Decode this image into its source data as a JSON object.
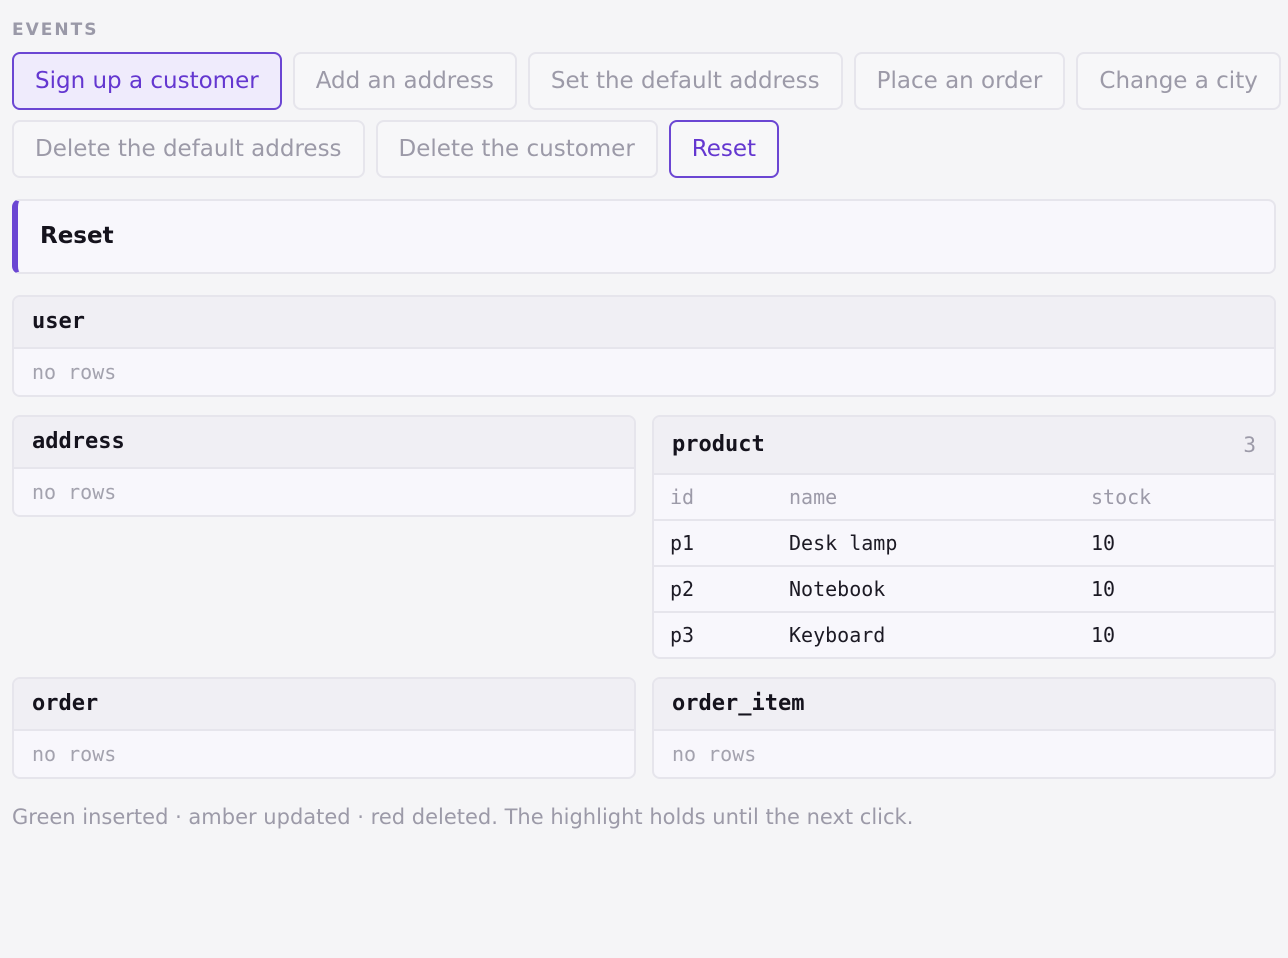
{
  "events": {
    "heading": "EVENTS",
    "buttons": [
      {
        "label": "Sign up a customer",
        "state": "active"
      },
      {
        "label": "Add an address",
        "state": "idle"
      },
      {
        "label": "Set the default address",
        "state": "idle"
      },
      {
        "label": "Place an order",
        "state": "idle"
      },
      {
        "label": "Change a city",
        "state": "idle"
      },
      {
        "label": "Delete the default address",
        "state": "idle"
      },
      {
        "label": "Delete the customer",
        "state": "idle"
      },
      {
        "label": "Reset",
        "state": "reset"
      }
    ]
  },
  "banner": {
    "title": "Reset"
  },
  "tables": {
    "user": {
      "name": "user",
      "empty": "no rows"
    },
    "address": {
      "name": "address",
      "empty": "no rows"
    },
    "product": {
      "name": "product",
      "count": "3",
      "columns": [
        "id",
        "name",
        "stock"
      ],
      "rows": [
        [
          "p1",
          "Desk lamp",
          "10"
        ],
        [
          "p2",
          "Notebook",
          "10"
        ],
        [
          "p3",
          "Keyboard",
          "10"
        ]
      ]
    },
    "order": {
      "name": "order",
      "empty": "no rows"
    },
    "order_item": {
      "name": "order_item",
      "empty": "no rows"
    }
  },
  "footnote": "Green inserted · amber updated · red deleted. The highlight holds until the next click.",
  "colors": {
    "accent": "#6b46d3",
    "accent_text": "#6437d0",
    "muted_text": "#9c9aa8",
    "border": "#e6e5ec"
  }
}
